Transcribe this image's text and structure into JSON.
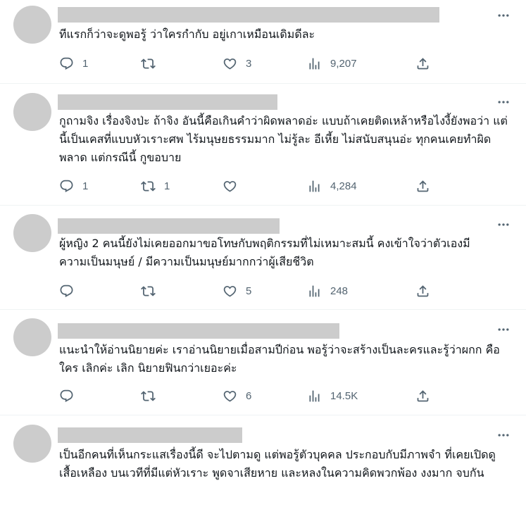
{
  "replies": [
    {
      "text": "ทีแรกก็ว่าจะดูพอรู้ ว่าใครกำกับ อยู่เกาเหมือนเดิมดีละ",
      "replies": "1",
      "retweets": "",
      "likes": "3",
      "views": "9,207"
    },
    {
      "text": "กูถามจิง เรื่องจิงป่ะ ถ้าจิง อันนี้คือเกินคำว่าผิดพลาดอ่ะ แบบถ้าเคยติดเหล้าหรือไงงี้ยังพอว่า แต่นี้เป็นเคสที่แบบหัวเราะศพ ไร้มนุษยธรรมมาก ไม่รู้ละ อีเหี้ย ไม่สนับสนุนอ่ะ ทุกคนเคยทำผิดพลาด แต่กรณีนี้ กูขอบาย",
      "replies": "1",
      "retweets": "1",
      "likes": "",
      "views": "4,284"
    },
    {
      "text": "ผู้หญิง 2 คนนี้ยังไม่เคยออกมาขอโทษกับพฤติกรรมที่ไม่เหมาะสมนี้ คงเข้าใจว่าตัวเองมีความเป็นมนุษย์ / มีความเป็นมนุษย์มากกว่าผู้เสียชีวิต",
      "replies": "",
      "retweets": "",
      "likes": "5",
      "views": "248"
    },
    {
      "text": "แนะนำให้อ่านนิยายค่ะ เราอ่านนิยายเมื่อสามปีก่อน พอรู้ว่าจะสร้างเป็นละครและรู้ว่าผกก คือใคร เลิกค่ะ เลิก นิยายฟินกว่าเยอะค่ะ",
      "replies": "",
      "retweets": "",
      "likes": "6",
      "views": "14.5K"
    },
    {
      "text": "เป็นอีกคนที่เห็นกระแสเรื่องนี้ดี จะไปตามดู แต่พอรู้ตัวบุคคล ประกอบกับมีภาพจำ ที่เคยเปิดดูเสื้อเหลือง บนเวทีที่มีแต่หัวเราะ พูดจาเสียหาย และหลงในความคิดพวกพ้อง งงมาก จบกัน",
      "replies": "",
      "retweets": "",
      "likes": "",
      "views": ""
    }
  ]
}
